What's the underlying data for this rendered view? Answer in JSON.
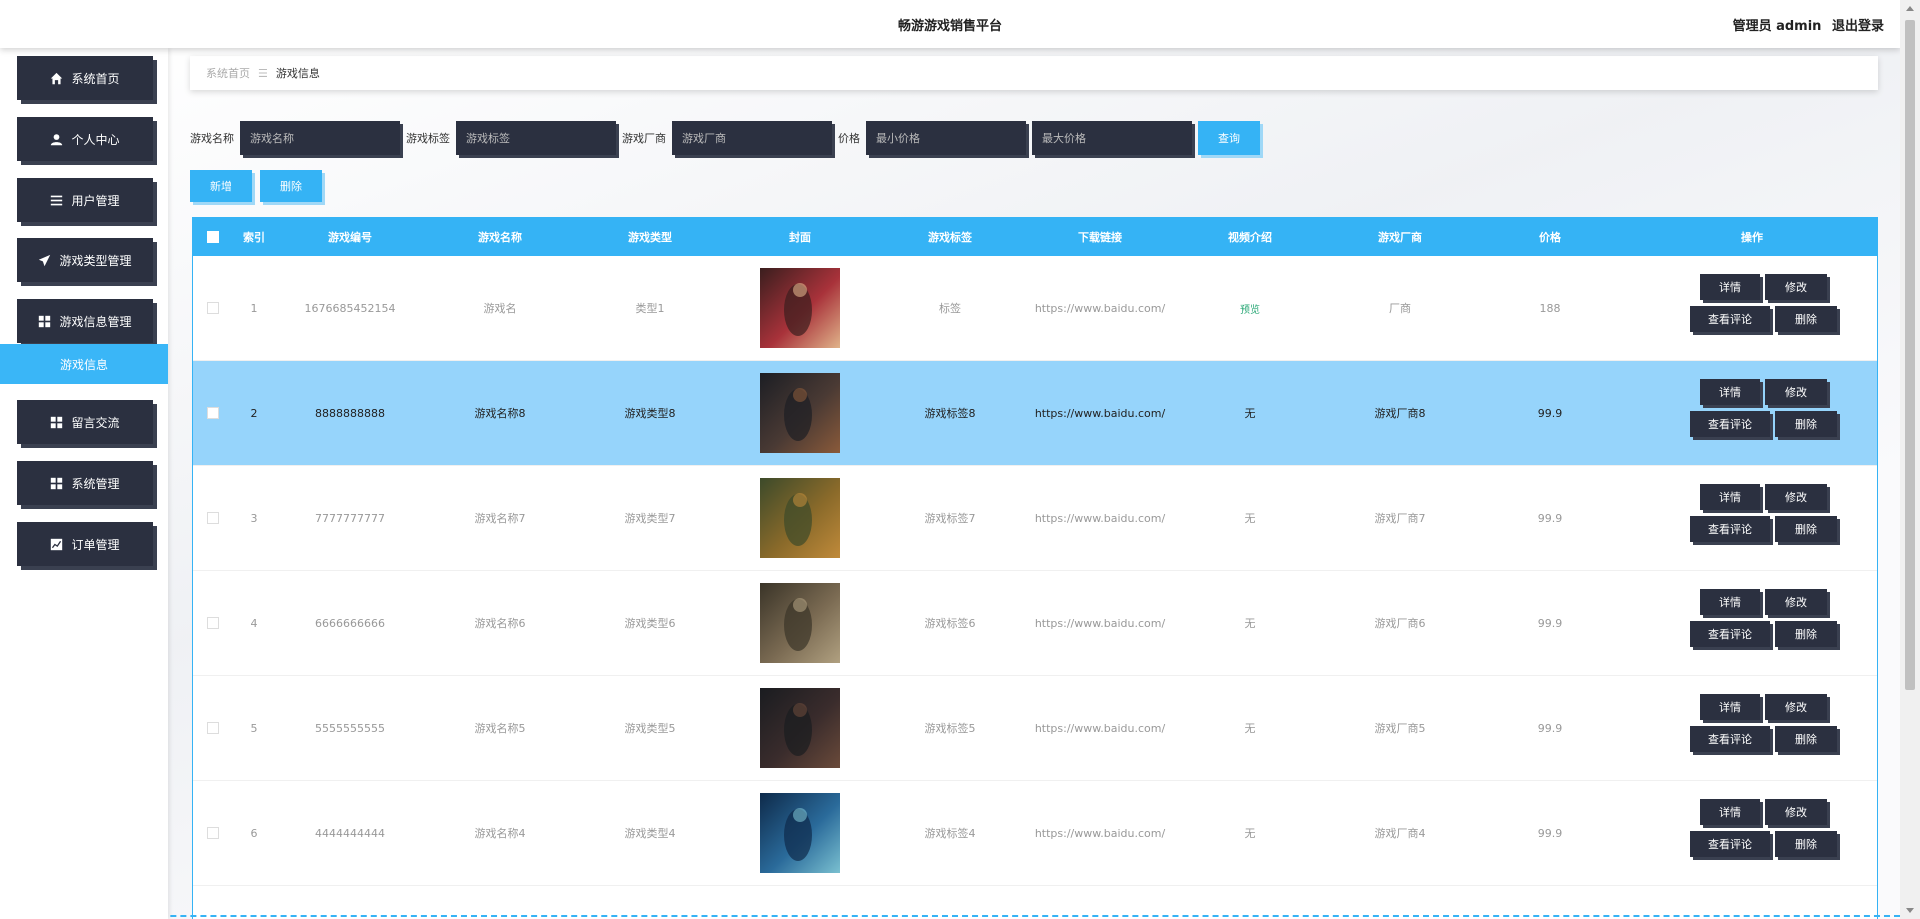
{
  "header": {
    "title": "畅游游戏销售平台",
    "role": "管理员 admin",
    "logout": "退出登录"
  },
  "sidebar": {
    "items": [
      {
        "label": "系统首页",
        "icon": "home-icon"
      },
      {
        "label": "个人中心",
        "icon": "user-icon"
      },
      {
        "label": "用户管理",
        "icon": "list-icon"
      },
      {
        "label": "游戏类型管理",
        "icon": "paper-plane-icon"
      },
      {
        "label": "游戏信息管理",
        "icon": "grid-icon"
      },
      {
        "label": "留言交流",
        "icon": "grid-icon"
      },
      {
        "label": "系统管理",
        "icon": "grid-icon"
      },
      {
        "label": "订单管理",
        "icon": "chart-icon"
      }
    ],
    "active_sub": "游戏信息"
  },
  "breadcrumb": {
    "home": "系统首页",
    "separator": "☰",
    "current": "游戏信息"
  },
  "search": {
    "name_label": "游戏名称",
    "name_placeholder": "游戏名称",
    "tag_label": "游戏标签",
    "tag_placeholder": "游戏标签",
    "vendor_label": "游戏厂商",
    "vendor_placeholder": "游戏厂商",
    "price_label": "价格",
    "min_placeholder": "最小价格",
    "max_placeholder": "最大价格",
    "query_button": "查询"
  },
  "actions": {
    "add": "新增",
    "delete": "删除"
  },
  "table": {
    "columns": [
      "索引",
      "游戏编号",
      "游戏名称",
      "游戏类型",
      "封面",
      "游戏标签",
      "下载链接",
      "视频介绍",
      "游戏厂商",
      "价格",
      "操作"
    ],
    "op_labels": {
      "detail": "详情",
      "edit": "修改",
      "comments": "查看评论",
      "delete": "删除"
    },
    "rows": [
      {
        "index": "1",
        "code": "1676685452154",
        "name": "游戏名",
        "type": "类型1",
        "tag": "标签",
        "link": "https://www.baidu.com/",
        "video": "预览",
        "vendor": "厂商",
        "price": "188",
        "selected": false
      },
      {
        "index": "2",
        "code": "8888888888",
        "name": "游戏名称8",
        "type": "游戏类型8",
        "tag": "游戏标签8",
        "link": "https://www.baidu.com/",
        "video": "无",
        "vendor": "游戏厂商8",
        "price": "99.9",
        "selected": true
      },
      {
        "index": "3",
        "code": "7777777777",
        "name": "游戏名称7",
        "type": "游戏类型7",
        "tag": "游戏标签7",
        "link": "https://www.baidu.com/",
        "video": "无",
        "vendor": "游戏厂商7",
        "price": "99.9",
        "selected": false
      },
      {
        "index": "4",
        "code": "6666666666",
        "name": "游戏名称6",
        "type": "游戏类型6",
        "tag": "游戏标签6",
        "link": "https://www.baidu.com/",
        "video": "无",
        "vendor": "游戏厂商6",
        "price": "99.9",
        "selected": false
      },
      {
        "index": "5",
        "code": "5555555555",
        "name": "游戏名称5",
        "type": "游戏类型5",
        "tag": "游戏标签5",
        "link": "https://www.baidu.com/",
        "video": "无",
        "vendor": "游戏厂商5",
        "price": "99.9",
        "selected": false
      },
      {
        "index": "6",
        "code": "4444444444",
        "name": "游戏名称4",
        "type": "游戏类型4",
        "tag": "游戏标签4",
        "link": "https://www.baidu.com/",
        "video": "无",
        "vendor": "游戏厂商4",
        "price": "99.9",
        "selected": false
      }
    ]
  },
  "colors": {
    "accent": "#35b3f5",
    "dark": "#2b3040",
    "selected_row": "#96d4fb",
    "preview_link": "#2aa876"
  }
}
